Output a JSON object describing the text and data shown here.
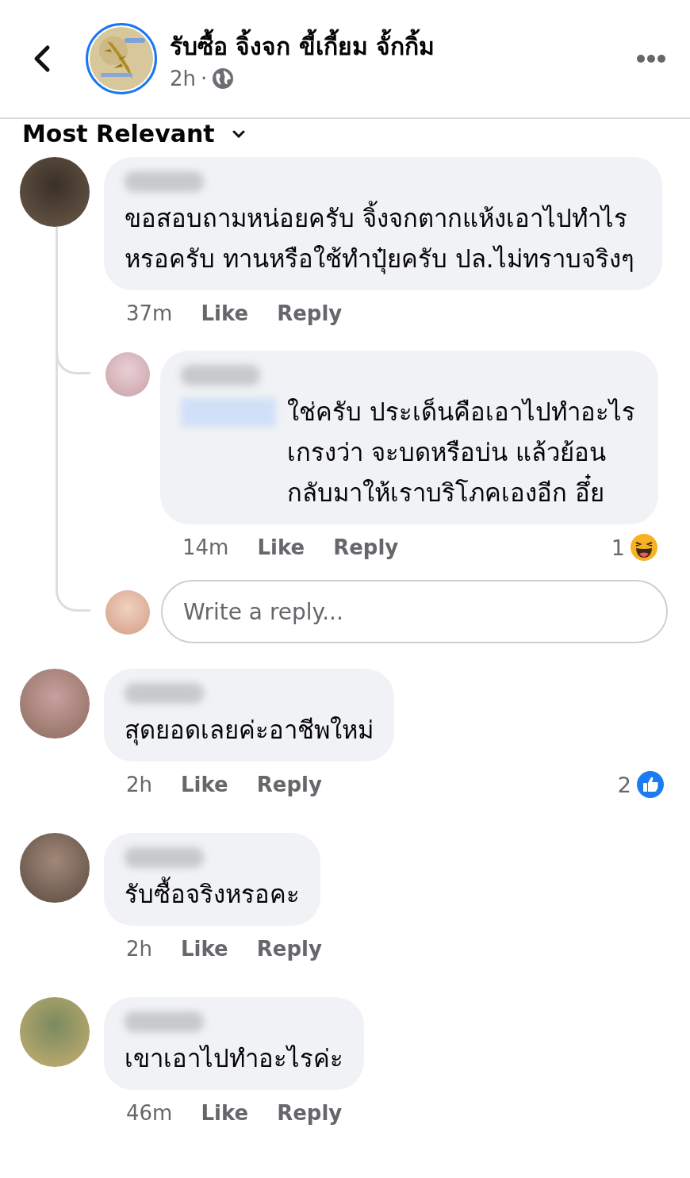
{
  "header": {
    "title": "รับซื้อ จิ้งจก ขี้เกี้ยม จั้กกิ้ม",
    "time": "2h",
    "separator": "·"
  },
  "sort": {
    "label": "Most Relevant"
  },
  "comments": [
    {
      "text": "ขอสอบถามหน่อยครับ จิ้งจกตากแห้งเอาไปทำไรหรอครับ ทานหรือใช้ทำปุ๋ยครับ ปล.ไม่ทราบจริงๆ",
      "time": "37m",
      "like": "Like",
      "reply": "Reply",
      "replies": [
        {
          "text": "ใช่ครับ ประเด็นคือเอาไปทำอะไร เกรงว่า จะบดหรือบ่น แล้วย้อนกลับมาให้เราบริโภคเองอีก อึ๋ย",
          "time": "14m",
          "like": "Like",
          "reply": "Reply",
          "reaction": {
            "count": "1",
            "kind": "haha"
          }
        }
      ],
      "composer": {
        "placeholder": "Write a reply..."
      }
    },
    {
      "text": "สุดยอดเลยค่ะอาชีพใหม่",
      "time": "2h",
      "like": "Like",
      "reply": "Reply",
      "reaction": {
        "count": "2",
        "kind": "like"
      }
    },
    {
      "text": "รับซื้อจริงหรอคะ",
      "time": "2h",
      "like": "Like",
      "reply": "Reply"
    },
    {
      "text": "เขาเอาไปทำอะไรค่ะ",
      "time": "46m",
      "like": "Like",
      "reply": "Reply"
    }
  ]
}
